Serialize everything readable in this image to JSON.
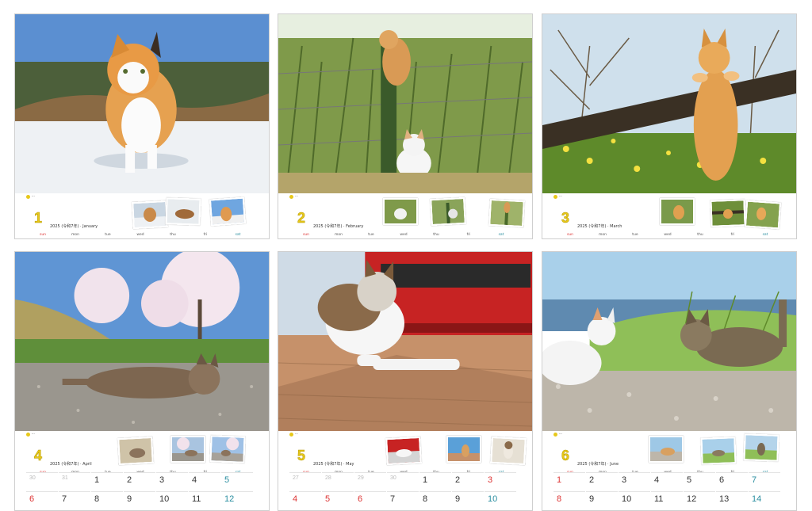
{
  "year": "2025",
  "weekday_labels": [
    "sun",
    "mon",
    "tue",
    "wed",
    "thu",
    "fri",
    "sat"
  ],
  "colors": {
    "month_number": "#e7c81a",
    "sunday": "#dd3333",
    "saturday": "#2a8ea0"
  },
  "pages": [
    {
      "number": "1",
      "label": "2025 (令和7年) · January"
    },
    {
      "number": "2",
      "label": "2025 (令和7年) · February"
    },
    {
      "number": "3",
      "label": "2025 (令和7年) · March"
    },
    {
      "number": "4",
      "label": "2025 (令和7年) · April",
      "week1": [
        "30",
        "31",
        "1",
        "2",
        "3",
        "4",
        "5"
      ],
      "week2": [
        "6",
        "7",
        "8",
        "9",
        "10",
        "11",
        "12"
      ]
    },
    {
      "number": "5",
      "label": "2025 (令和7年) · May",
      "week1": [
        "27",
        "28",
        "29",
        "30",
        "1",
        "2",
        "3"
      ],
      "week2": [
        "4",
        "5",
        "6",
        "7",
        "8",
        "9",
        "10"
      ]
    },
    {
      "number": "6",
      "label": "2025 (令和7年) · June",
      "week1": [
        "1",
        "2",
        "3",
        "4",
        "5",
        "6",
        "7"
      ],
      "week2": [
        "8",
        "9",
        "10",
        "11",
        "12",
        "13",
        "14"
      ]
    }
  ]
}
